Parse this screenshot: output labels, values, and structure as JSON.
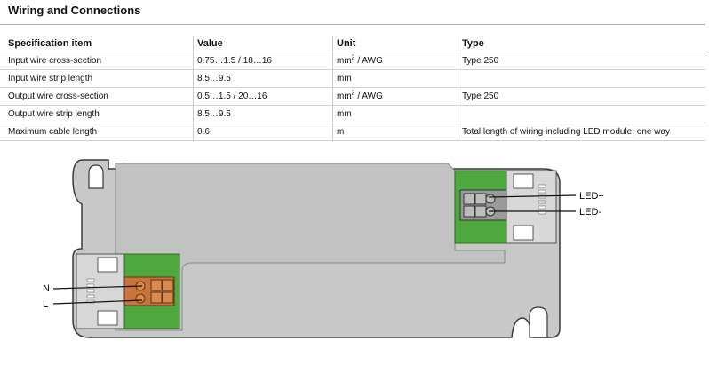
{
  "section": {
    "title": "Wiring and Connections"
  },
  "table": {
    "headers": [
      "Specification item",
      "Value",
      "Unit",
      "Type"
    ],
    "rows": [
      {
        "item": "Input wire cross-section",
        "value": "0.75…1.5 / 18…16",
        "unit_base": "mm",
        "unit_sup": "2",
        "unit_rest": " / AWG",
        "type": "Type 250"
      },
      {
        "item": "Input wire strip length",
        "value": "8.5…9.5",
        "unit_base": "mm",
        "unit_sup": "",
        "unit_rest": "",
        "type": ""
      },
      {
        "item": "Output wire cross-section",
        "value": "0.5…1.5 / 20…16",
        "unit_base": "mm",
        "unit_sup": "2",
        "unit_rest": " / AWG",
        "type": "Type 250"
      },
      {
        "item": "Output wire strip length",
        "value": "8.5…9.5",
        "unit_base": "mm",
        "unit_sup": "",
        "unit_rest": "",
        "type": ""
      },
      {
        "item": "Maximum cable length",
        "value": "0.6",
        "unit_base": "m",
        "unit_sup": "",
        "unit_rest": "",
        "type": "Total length of wiring including LED module, one way"
      }
    ]
  },
  "diagram": {
    "labels": {
      "n": "N",
      "l": "L",
      "led_plus": "LED+",
      "led_minus": "LED-"
    },
    "colors": {
      "housing": "#c8c8c8",
      "outline": "#3a3a3a",
      "terminal_green": "#4fa83d",
      "connector_orange": "#c8743a"
    }
  }
}
